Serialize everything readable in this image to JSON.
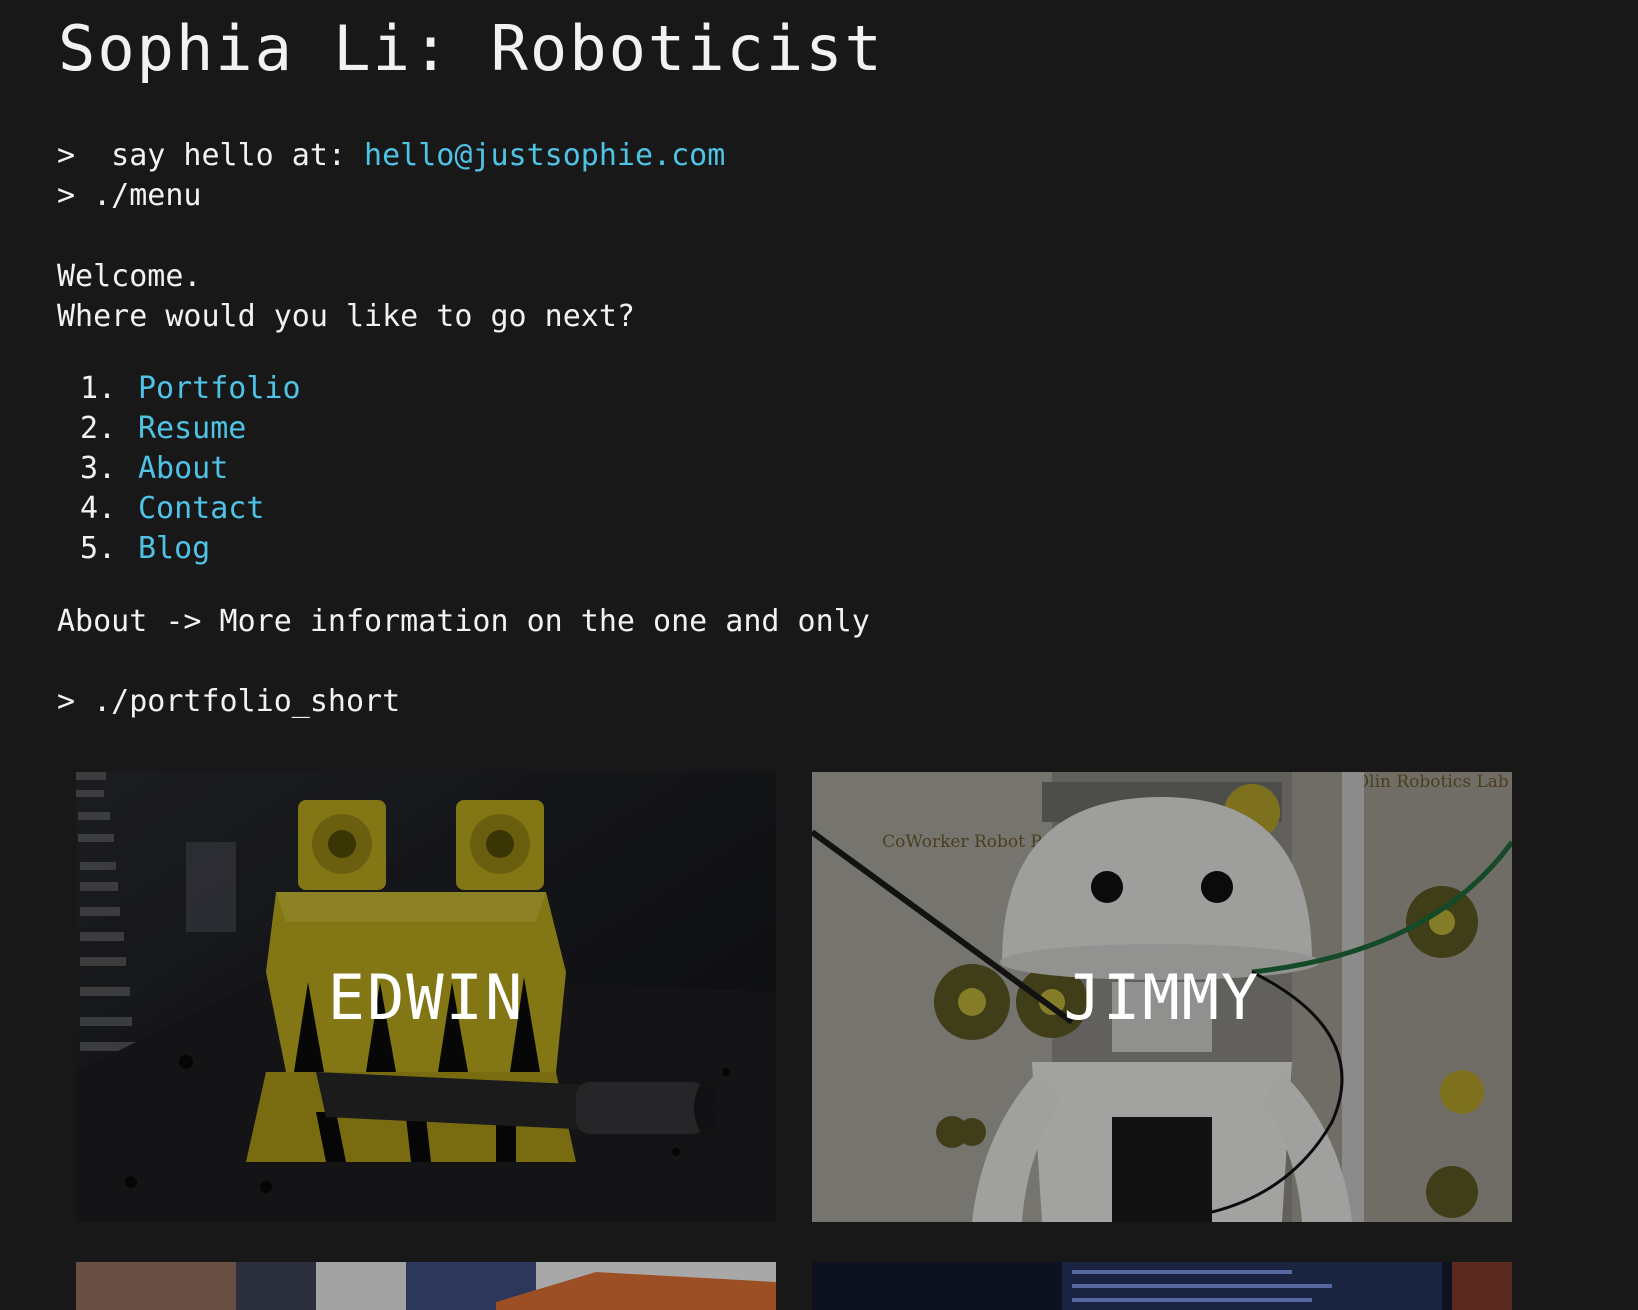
{
  "header": {
    "title": "Sophia Li: Roboticist"
  },
  "contact": {
    "prompt": ">",
    "say_hello_label": "  say hello at: ",
    "email": "hello@justsophie.com"
  },
  "menu_cmd": {
    "prompt": ">",
    "command": " ./menu"
  },
  "welcome": {
    "line1": "Welcome.",
    "line2": "Where would you like to go next?"
  },
  "menu": {
    "items": [
      {
        "num": "1.",
        "label": "Portfolio"
      },
      {
        "num": "2.",
        "label": "Resume"
      },
      {
        "num": "3.",
        "label": "About"
      },
      {
        "num": "4.",
        "label": "Contact"
      },
      {
        "num": "5.",
        "label": "Blog"
      }
    ]
  },
  "hover_info": "About -> More information on the one and only",
  "portfolio_cmd": {
    "prompt": ">",
    "command": "./portfolio_short"
  },
  "portfolio": {
    "cards": [
      {
        "label": "EDWIN"
      },
      {
        "label": "JIMMY"
      }
    ],
    "jimmy_poster": {
      "poster_left": "CoWorker Robot Project",
      "poster_right": "Olin Robotics Lab"
    }
  },
  "colors": {
    "background": "#181818",
    "text": "#f2f2f2",
    "link": "#4fc3e6"
  }
}
